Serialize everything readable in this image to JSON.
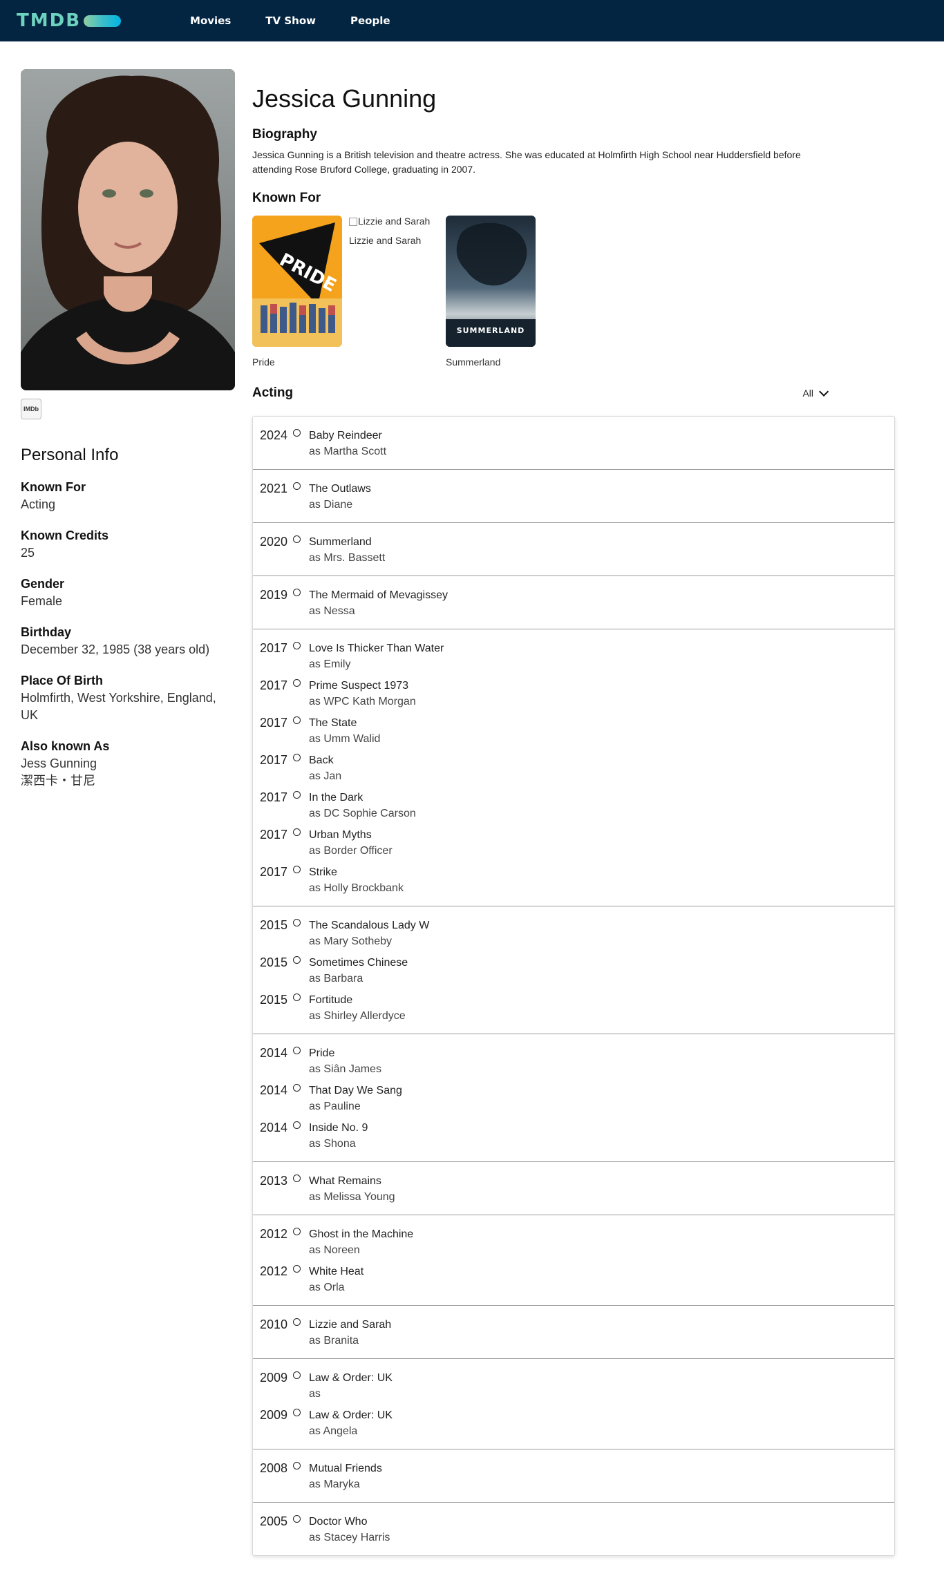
{
  "header": {
    "logo_text": "TMDB",
    "nav": [
      "Movies",
      "TV Show",
      "People"
    ]
  },
  "person": {
    "name": "Jessica Gunning",
    "imdb_label": "IMDb",
    "biography_title": "Biography",
    "biography": "Jessica Gunning is a British television and theatre actress. She was educated at Holmfirth High School near Huddersfield before attending Rose Bruford College, graduating in 2007."
  },
  "personal_info": {
    "heading": "Personal Info",
    "fields": [
      {
        "label": "Known For",
        "value": "Acting"
      },
      {
        "label": "Known Credits",
        "value": "25"
      },
      {
        "label": "Gender",
        "value": "Female"
      },
      {
        "label": "Birthday",
        "value": "December 32, 1985 (38 years old)"
      },
      {
        "label": "Place Of Birth",
        "value": "Holmfirth, West Yorkshire, England, UK"
      },
      {
        "label": "Also known As",
        "value": "Jess Gunning",
        "value2": "潔西卡・甘尼"
      }
    ]
  },
  "known_for": {
    "title": "Known For",
    "items": [
      {
        "caption": "Pride",
        "poster_text": "PRIDE"
      },
      {
        "caption": "Lizzie and Sarah",
        "alt": "Lizzie and Sarah"
      },
      {
        "caption": "Summerland",
        "poster_text": "SUMMERLAND"
      }
    ]
  },
  "acting": {
    "title": "Acting",
    "filter": "All",
    "groups": [
      [
        {
          "year": "2024",
          "title": "Baby Reindeer",
          "role": "as Martha Scott"
        }
      ],
      [
        {
          "year": "2021",
          "title": "The Outlaws",
          "role": "as Diane"
        }
      ],
      [
        {
          "year": "2020",
          "title": "Summerland",
          "role": "as Mrs. Bassett"
        }
      ],
      [
        {
          "year": "2019",
          "title": "The Mermaid of Mevagissey",
          "role": "as Nessa"
        }
      ],
      [
        {
          "year": "2017",
          "title": "Love Is Thicker Than Water",
          "role": "as Emily"
        },
        {
          "year": "2017",
          "title": "Prime Suspect 1973",
          "role": "as WPC Kath Morgan"
        },
        {
          "year": "2017",
          "title": "The State",
          "role": "as Umm Walid"
        },
        {
          "year": "2017",
          "title": "Back",
          "role": "as Jan"
        },
        {
          "year": "2017",
          "title": "In the Dark",
          "role": "as DC Sophie Carson"
        },
        {
          "year": "2017",
          "title": "Urban Myths",
          "role": "as Border Officer"
        },
        {
          "year": "2017",
          "title": "Strike",
          "role": "as Holly Brockbank"
        }
      ],
      [
        {
          "year": "2015",
          "title": "The Scandalous Lady W",
          "role": "as Mary Sotheby"
        },
        {
          "year": "2015",
          "title": "Sometimes Chinese",
          "role": "as Barbara"
        },
        {
          "year": "2015",
          "title": "Fortitude",
          "role": "as Shirley Allerdyce"
        }
      ],
      [
        {
          "year": "2014",
          "title": "Pride",
          "role": "as Siân James"
        },
        {
          "year": "2014",
          "title": "That Day We Sang",
          "role": "as Pauline"
        },
        {
          "year": "2014",
          "title": "Inside No. 9",
          "role": "as Shona"
        }
      ],
      [
        {
          "year": "2013",
          "title": "What Remains",
          "role": "as Melissa Young"
        }
      ],
      [
        {
          "year": "2012",
          "title": "Ghost in the Machine",
          "role": "as Noreen"
        },
        {
          "year": "2012",
          "title": "White Heat",
          "role": "as Orla"
        }
      ],
      [
        {
          "year": "2010",
          "title": "Lizzie and Sarah",
          "role": "as Branita"
        }
      ],
      [
        {
          "year": "2009",
          "title": "Law & Order: UK",
          "role": "as"
        },
        {
          "year": "2009",
          "title": "Law & Order: UK",
          "role": "as Angela"
        }
      ],
      [
        {
          "year": "2008",
          "title": "Mutual Friends",
          "role": "as Maryka"
        }
      ],
      [
        {
          "year": "2005",
          "title": "Doctor Who",
          "role": "as Stacey Harris"
        }
      ]
    ]
  }
}
